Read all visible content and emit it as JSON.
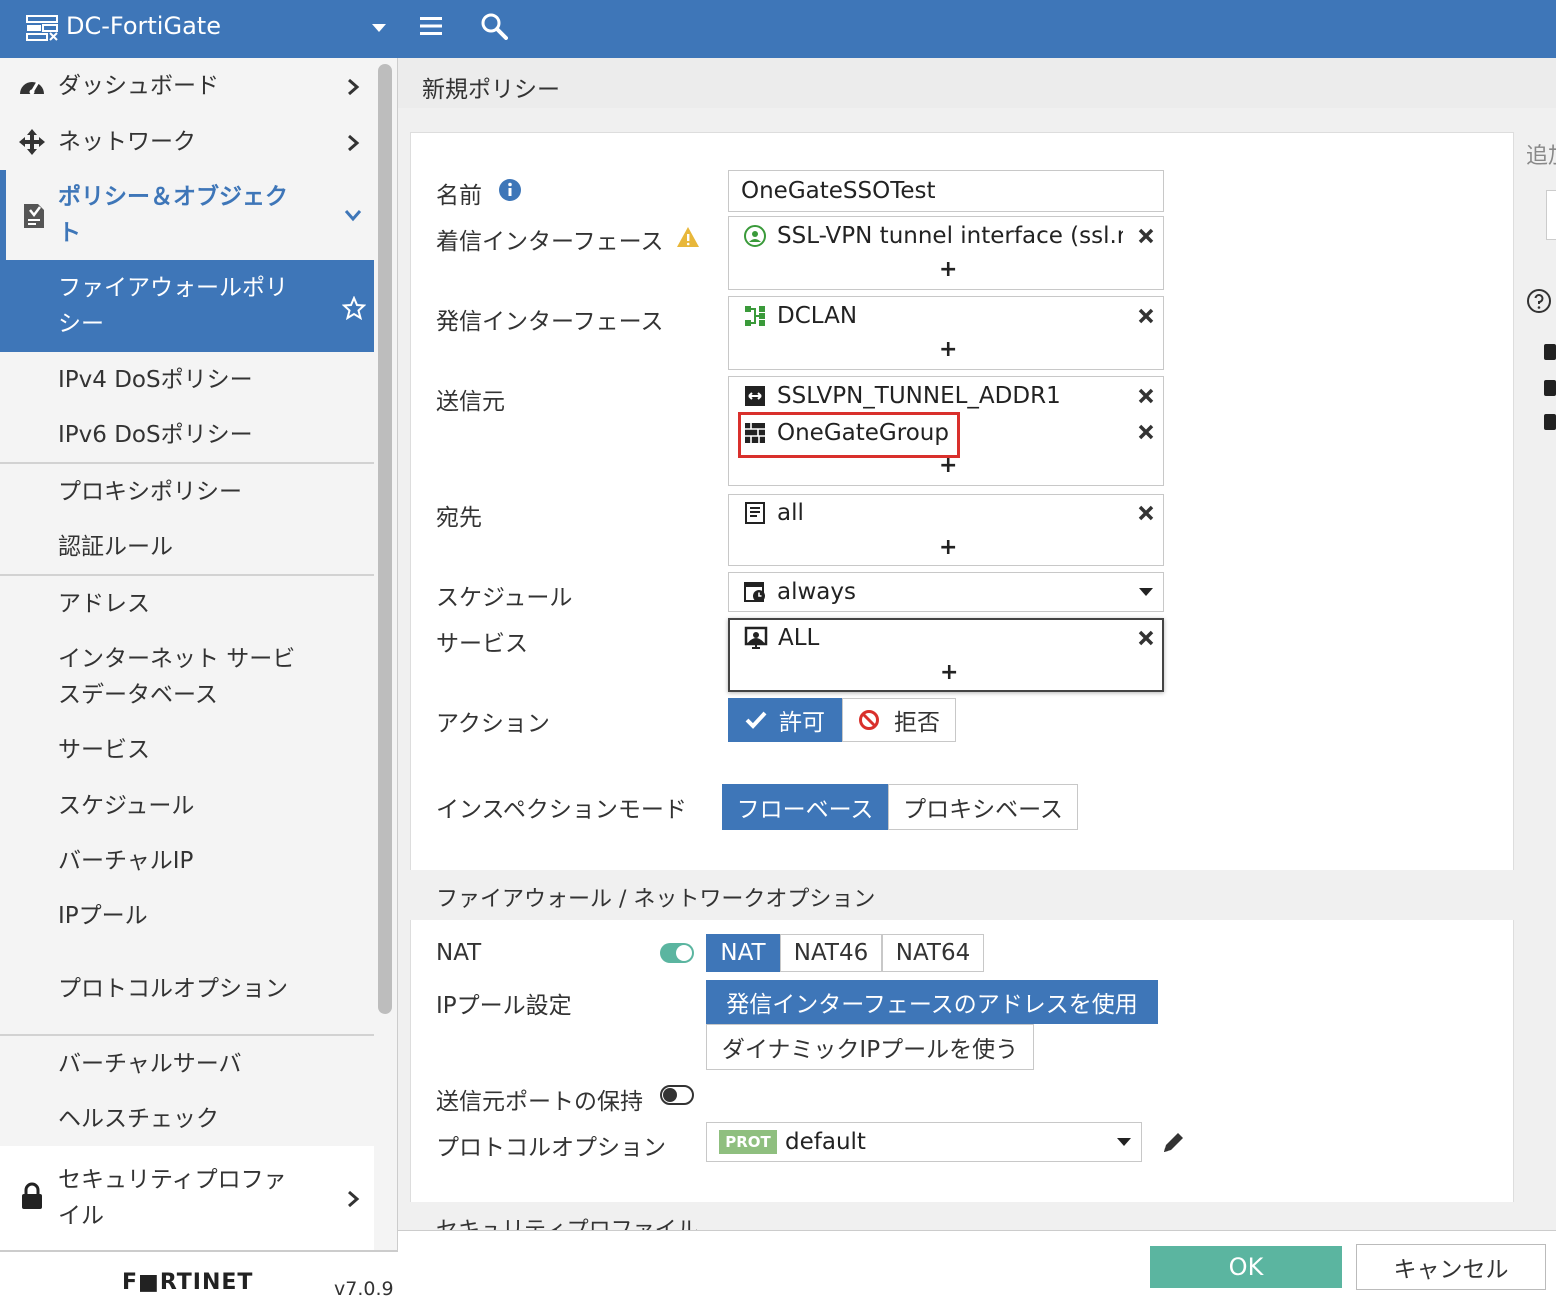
{
  "topbar": {
    "title": "DC-FortiGate"
  },
  "sidebar": {
    "dashboard": "ダッシュボード",
    "network": "ネットワーク",
    "policy_objects": "ポリシー＆オブジェクト",
    "firewall_policy": "ファイアウォールポリシー",
    "ipv4_dos": "IPv4 DoSポリシー",
    "ipv6_dos": "IPv6 DoSポリシー",
    "proxy_policy": "プロキシポリシー",
    "auth_rules": "認証ルール",
    "addresses": "アドレス",
    "internet_service_db": "インターネット サービスデータベース",
    "services": "サービス",
    "schedules": "スケジュール",
    "virtual_ip": "バーチャルIP",
    "ip_pools": "IPプール",
    "protocol_options": "プロトコルオプション",
    "virtual_server": "バーチャルサーバ",
    "health_check": "ヘルスチェック",
    "security_profiles": "セキュリティプロファイル",
    "brand": "F■RTINET",
    "version": "v7.0.9"
  },
  "page": {
    "title": "新規ポリシー",
    "side_fragment": "追加"
  },
  "form": {
    "name_label": "名前",
    "name_value": "OneGateSSOTest",
    "incoming_label": "着信インターフェース",
    "incoming_value": "SSL-VPN tunnel interface (ssl.roo",
    "outgoing_label": "発信インターフェース",
    "outgoing_value": "DCLAN",
    "source_label": "送信元",
    "source_values": [
      "SSLVPN_TUNNEL_ADDR1",
      "OneGateGroup"
    ],
    "dest_label": "宛先",
    "dest_value": "all",
    "schedule_label": "スケジュール",
    "schedule_value": "always",
    "service_label": "サービス",
    "service_value": "ALL",
    "action_label": "アクション",
    "action_accept": "許可",
    "action_deny": "拒否",
    "inspection_label": "インスペクションモード",
    "inspection_flow": "フローベース",
    "inspection_proxy": "プロキシベース",
    "plus": "+"
  },
  "fw_options": {
    "section_title": "ファイアウォール / ネットワークオプション",
    "nat_label": "NAT",
    "nat_options": [
      "NAT",
      "NAT46",
      "NAT64"
    ],
    "ip_pool_label": "IPプール設定",
    "ip_pool_opt1": "発信インターフェースのアドレスを使用",
    "ip_pool_opt2": "ダイナミックIPプールを使う",
    "preserve_port_label": "送信元ポートの保持",
    "protocol_options_label": "プロトコルオプション",
    "prot_badge": "PROT",
    "protocol_options_value": "default"
  },
  "security_section": {
    "title": "セキュリティプロファイル"
  },
  "footer": {
    "ok": "OK",
    "cancel": "キャンセル"
  },
  "colors": {
    "brand_blue": "#3e76b8",
    "ok_green": "#5bb5a0",
    "toggle_on": "#5bb5a0",
    "highlight_red": "#d9302c"
  }
}
